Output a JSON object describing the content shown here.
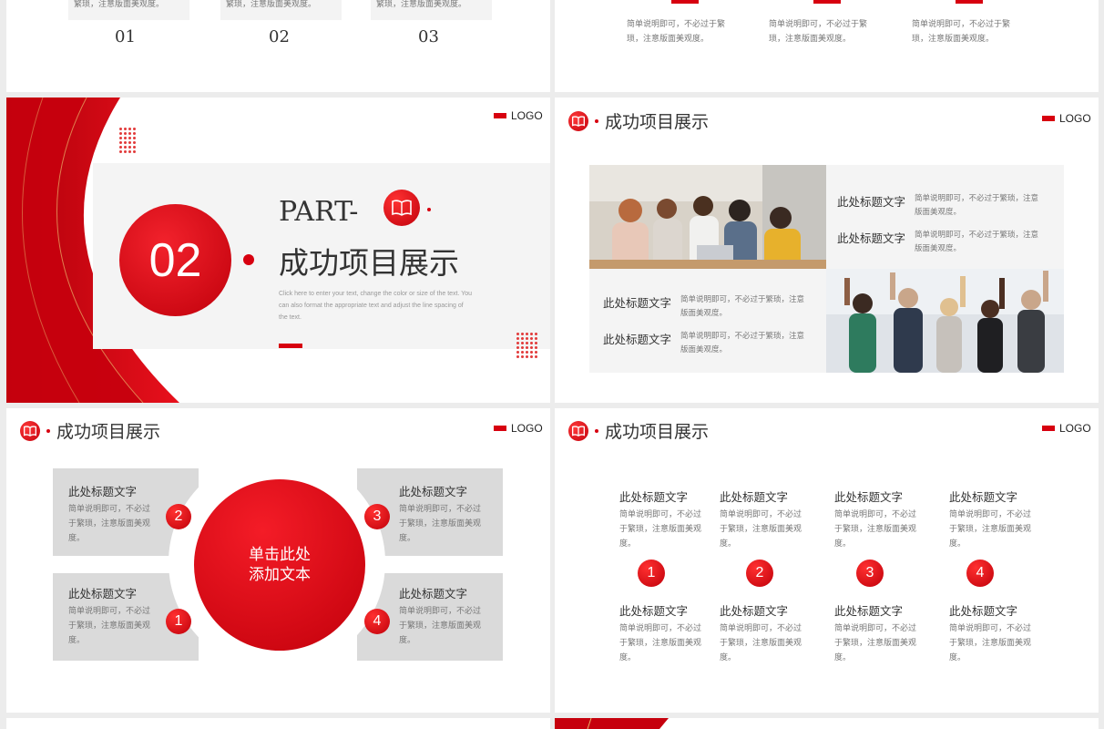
{
  "top_left": {
    "items": [
      {
        "text": "繁琐，注意版面美观度。",
        "num": "01"
      },
      {
        "text": "繁琐，注意版面美观度。",
        "num": "02"
      },
      {
        "text": "繁琐，注意版面美观度。",
        "num": "03"
      }
    ]
  },
  "top_right": {
    "items": [
      {
        "line1": "简单说明即可，不必过于繁",
        "line2": "琐，注意版面美观度。"
      },
      {
        "line1": "简单说明即可，不必过于繁",
        "line2": "琐，注意版面美观度。"
      },
      {
        "line1": "简单说明即可，不必过于繁",
        "line2": "琐，注意版面美观度。"
      }
    ]
  },
  "logo_text": "LOGO",
  "section_title": "成功项目展示",
  "part_slide": {
    "part_label": "PART-",
    "number": "02",
    "title": "成功项目展示",
    "desc1": "Click here to enter your text, change the color or size of the text. You",
    "desc2": "can also format the appropriate text and adjust the line spacing of",
    "desc3": "the text."
  },
  "photo_slide": {
    "cells": [
      {
        "title": "此处标题文字",
        "line1": "简单说明即可，不必过于繁琐，注意",
        "line2": "版面美观度。"
      },
      {
        "title": "此处标题文字",
        "line1": "简单说明即可，不必过于繁琐，注意",
        "line2": "版面美观度。"
      },
      {
        "title": "此处标题文字",
        "line1": "简单说明即可，不必过于繁琐，注意",
        "line2": "版面美观度。"
      },
      {
        "title": "此处标题文字",
        "line1": "简单说明即可，不必过于繁琐，注意",
        "line2": "版面美观度。"
      }
    ]
  },
  "circle_slide": {
    "center_line1": "单击此处",
    "center_line2": "添加文本",
    "boxes": [
      {
        "num": "2",
        "title": "此处标题文字",
        "l1": "简单说明即可，不必过",
        "l2": "于繁琐，注意版面美观",
        "l3": "度。"
      },
      {
        "num": "3",
        "title": "此处标题文字",
        "l1": "简单说明即可，不必过",
        "l2": "于繁琐，注意版面美观",
        "l3": "度。"
      },
      {
        "num": "1",
        "title": "此处标题文字",
        "l1": "简单说明即可，不必过",
        "l2": "于繁琐，注意版面美观",
        "l3": "度。"
      },
      {
        "num": "4",
        "title": "此处标题文字",
        "l1": "简单说明即可，不必过",
        "l2": "于繁琐，注意版面美观",
        "l3": "度。"
      }
    ]
  },
  "four_slide": {
    "columns": [
      {
        "num": "1",
        "top": {
          "title": "此处标题文字",
          "l1": "简单说明即可，不必过",
          "l2": "于繁琐，注意版面美观",
          "l3": "度。"
        },
        "bottom": {
          "title": "此处标题文字",
          "l1": "简单说明即可，不必过",
          "l2": "于繁琐，注意版面美观",
          "l3": "度。"
        }
      },
      {
        "num": "2",
        "top": {
          "title": "此处标题文字",
          "l1": "简单说明即可，不必过",
          "l2": "于繁琐，注意版面美观",
          "l3": "度。"
        },
        "bottom": {
          "title": "此处标题文字",
          "l1": "简单说明即可，不必过",
          "l2": "于繁琐，注意版面美观",
          "l3": "度。"
        }
      },
      {
        "num": "3",
        "top": {
          "title": "此处标题文字",
          "l1": "简单说明即可，不必过",
          "l2": "于繁琐，注意版面美观",
          "l3": "度。"
        },
        "bottom": {
          "title": "此处标题文字",
          "l1": "简单说明即可，不必过",
          "l2": "于繁琐，注意版面美观",
          "l3": "度。"
        }
      },
      {
        "num": "4",
        "top": {
          "title": "此处标题文字",
          "l1": "简单说明即可，不必过",
          "l2": "于繁琐，注意版面美观",
          "l3": "度。"
        },
        "bottom": {
          "title": "此处标题文字",
          "l1": "简单说明即可，不必过",
          "l2": "于繁琐，注意版面美观",
          "l3": "度。"
        }
      }
    ]
  },
  "colors": {
    "accent": "#d7000f",
    "panel": "#f5f5f5",
    "box": "#d9d9d9"
  },
  "icons": {
    "header_icon": "book-icon"
  }
}
